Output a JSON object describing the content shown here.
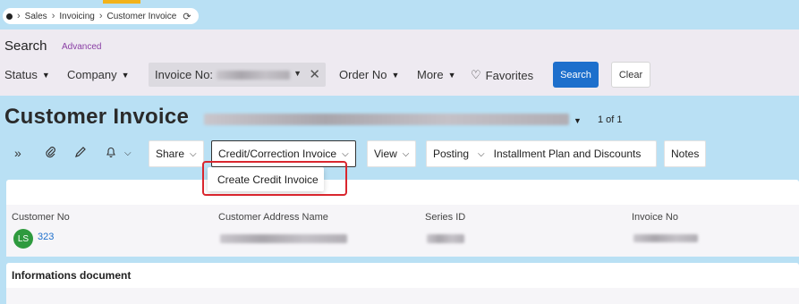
{
  "breadcrumb": {
    "items": [
      "Sales",
      "Invoicing",
      "Customer Invoice"
    ]
  },
  "search": {
    "title": "Search",
    "advanced_label": "Advanced",
    "filters": {
      "status": "Status",
      "company": "Company",
      "invoice_no_label": "Invoice No:",
      "invoice_no_value_visible": "2025070004",
      "order_no": "Order No",
      "more": "More",
      "favorites": "Favorites"
    },
    "search_button": "Search",
    "clear_button": "Clear"
  },
  "page": {
    "title": "Customer Invoice",
    "record_count": "1 of 1"
  },
  "toolbar": {
    "share": "Share",
    "credit_correction": "Credit/Correction Invoice",
    "view": "View",
    "posting": "Posting",
    "installment": "Installment Plan and Discounts",
    "notes": "Notes"
  },
  "dropdown": {
    "create_credit_invoice": "Create Credit Invoice"
  },
  "details": {
    "customer_no_label": "Customer No",
    "customer_no_value": "323",
    "avatar_initials": "LS",
    "customer_address_label": "Customer Address Name",
    "series_id_label": "Series ID",
    "series_id_visible": "A",
    "invoice_no_label": "Invoice No",
    "invoice_no_visible": "2025070004"
  },
  "informations": {
    "title": "Informations document"
  },
  "colors": {
    "accent": "#1d6fcc",
    "highlight": "#d9262e",
    "avatar": "#2e9a3e",
    "background": "#b9e0f4"
  }
}
